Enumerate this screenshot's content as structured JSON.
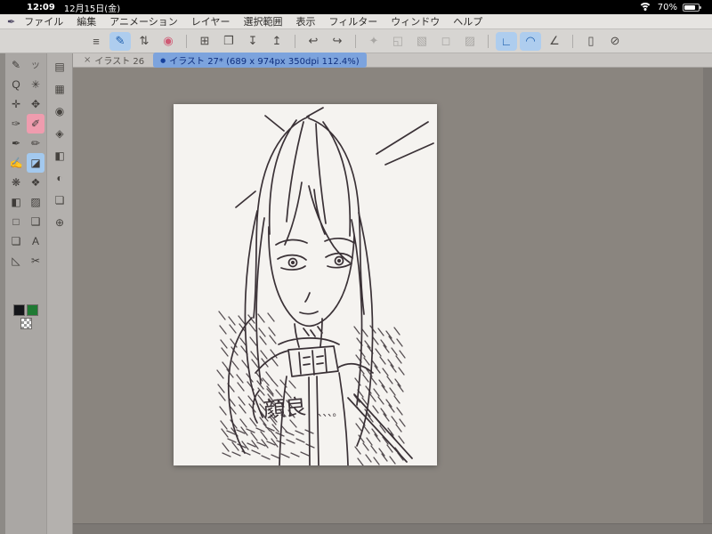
{
  "status_bar": {
    "time": "12:09",
    "date": "12月15日(金)",
    "battery_percent": "70%"
  },
  "menu_bar": {
    "logo_glyph": "✒",
    "items": [
      {
        "label": "ファイル"
      },
      {
        "label": "編集"
      },
      {
        "label": "アニメーション"
      },
      {
        "label": "レイヤー"
      },
      {
        "label": "選択範囲"
      },
      {
        "label": "表示"
      },
      {
        "label": "フィルター"
      },
      {
        "label": "ウィンドウ"
      },
      {
        "label": "ヘルプ"
      }
    ]
  },
  "toolbar": {
    "items": [
      {
        "name": "main-menu-icon",
        "glyph": "≡"
      },
      {
        "name": "edit-mode-icon",
        "glyph": "✎",
        "state": "active"
      },
      {
        "name": "tool-switcher-icon",
        "glyph": "⇅"
      },
      {
        "name": "clip-record-icon",
        "glyph": "◉",
        "state": "pink"
      },
      {
        "divider": true
      },
      {
        "name": "new-canvas-icon",
        "glyph": "⊞"
      },
      {
        "name": "open-file-icon",
        "glyph": "❐"
      },
      {
        "name": "save-icon",
        "glyph": "↧"
      },
      {
        "name": "share-icon",
        "glyph": "↥"
      },
      {
        "divider": true
      },
      {
        "name": "undo-icon",
        "glyph": "↩"
      },
      {
        "name": "redo-icon",
        "glyph": "↪"
      },
      {
        "divider": true
      },
      {
        "name": "deselect-icon",
        "glyph": "✦",
        "state": "disabled"
      },
      {
        "name": "invert-selection-icon",
        "glyph": "◱",
        "state": "disabled"
      },
      {
        "name": "selection-border-icon",
        "glyph": "▧",
        "state": "disabled"
      },
      {
        "name": "selection-launcher-icon",
        "glyph": "◻",
        "state": "disabled"
      },
      {
        "name": "fill-selection-icon",
        "glyph": "▨",
        "state": "disabled"
      },
      {
        "divider": true
      },
      {
        "name": "snap-ruler-icon",
        "glyph": "∟",
        "state": "active"
      },
      {
        "name": "snap-special-ruler-icon",
        "glyph": "◠",
        "state": "active"
      },
      {
        "name": "snap-grid-icon",
        "glyph": "∠"
      },
      {
        "divider": true
      },
      {
        "name": "companion-mode-icon",
        "glyph": "▯"
      },
      {
        "name": "reference-icon",
        "glyph": "⊘"
      }
    ]
  },
  "tabs": {
    "inactive": {
      "close": "×",
      "label": "イラスト 26"
    },
    "active": {
      "dot": "●",
      "label": "イラスト 27* (689 x 974px 350dpi 112.4%)"
    }
  },
  "tool_palette": {
    "items": [
      {
        "name": "pen-input-icon",
        "glyph": "✎"
      },
      {
        "name": "tool-panel-label",
        "glyph": "ツ",
        "small": true
      },
      {
        "name": "zoom-tool",
        "glyph": "Q"
      },
      {
        "name": "auto-select-tool",
        "glyph": "✳"
      },
      {
        "name": "move-tool",
        "glyph": "✛"
      },
      {
        "name": "pan-tool",
        "glyph": "✥"
      },
      {
        "name": "eyedropper-tool",
        "glyph": "✑"
      },
      {
        "name": "marker-tool",
        "glyph": "✐",
        "state": "selected-pink"
      },
      {
        "name": "pen-tool",
        "glyph": "✒"
      },
      {
        "name": "pencil-tool",
        "glyph": "✏"
      },
      {
        "name": "brush-tool",
        "glyph": "✍"
      },
      {
        "name": "eraser-tool",
        "glyph": "◪",
        "state": "selected-blue"
      },
      {
        "name": "airbrush-tool",
        "glyph": "❋"
      },
      {
        "name": "blend-tool",
        "glyph": "❖"
      },
      {
        "name": "fill-tool",
        "glyph": "◧"
      },
      {
        "name": "gradient-tool",
        "glyph": "▨"
      },
      {
        "name": "figure-tool",
        "glyph": "□"
      },
      {
        "name": "decoration-tool",
        "glyph": "❑"
      },
      {
        "name": "balloon-tool",
        "glyph": "❏"
      },
      {
        "name": "text-tool",
        "glyph": "A"
      },
      {
        "name": "ruler-tool",
        "glyph": "◺"
      },
      {
        "name": "correct-line-tool",
        "glyph": "✂"
      }
    ],
    "swatches": [
      {
        "name": "main-color-swatch",
        "color": "#15161a"
      },
      {
        "name": "sub-color-swatch",
        "color": "#1f7a33"
      },
      {
        "name": "transparent-color-swatch",
        "checker": true
      }
    ]
  },
  "dock_palette": {
    "items": [
      {
        "name": "quick-access-panel-icon",
        "glyph": "▤"
      },
      {
        "name": "material-panel-icon",
        "glyph": "▦"
      },
      {
        "name": "brush-size-panel-icon",
        "glyph": "◉"
      },
      {
        "name": "subtool-panel-icon",
        "glyph": "◈"
      },
      {
        "name": "tool-property-panel-icon",
        "glyph": "◧"
      },
      {
        "name": "color-wheel-panel-icon",
        "glyph": "◐"
      },
      {
        "name": "layer-panel-icon",
        "glyph": "❏"
      },
      {
        "name": "navigator-panel-icon",
        "glyph": "⊕"
      }
    ]
  },
  "canvas": {
    "annotation": "顔良",
    "annotation_dots": "、、、。"
  },
  "colors": {
    "accent_blue": "#3a7bd5",
    "highlight_pink": "#ef9cae",
    "canvas_bg": "#8a857f",
    "paper": "#f5f3f0",
    "ink": "#3a3136"
  }
}
